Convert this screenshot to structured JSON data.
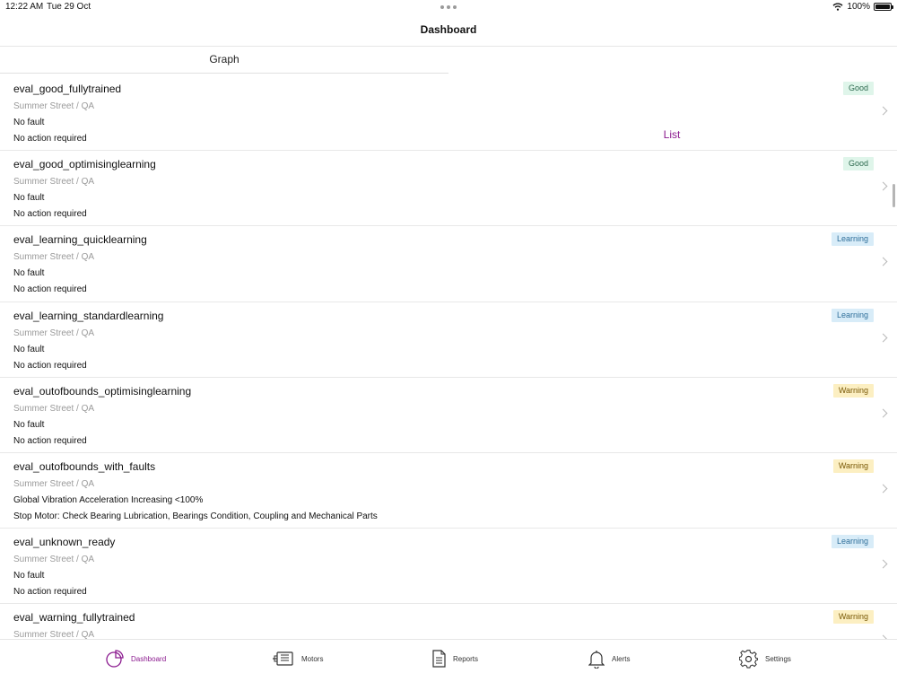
{
  "status": {
    "time": "12:22 AM",
    "date": "Tue 29 Oct",
    "battery": "100%"
  },
  "nav": {
    "title": "Dashboard"
  },
  "tabs": [
    {
      "label": "Graph"
    },
    {
      "label": "List"
    }
  ],
  "rows": [
    {
      "name": "eval_good_fullytrained",
      "location": "Summer Street / QA",
      "fault": "No fault",
      "action": "No action required",
      "status": "Good"
    },
    {
      "name": "eval_good_optimisinglearning",
      "location": "Summer Street / QA",
      "fault": "No fault",
      "action": "No action required",
      "status": "Good"
    },
    {
      "name": "eval_learning_quicklearning",
      "location": "Summer Street / QA",
      "fault": "No fault",
      "action": "No action required",
      "status": "Learning"
    },
    {
      "name": "eval_learning_standardlearning",
      "location": "Summer Street / QA",
      "fault": "No fault",
      "action": "No action required",
      "status": "Learning"
    },
    {
      "name": "eval_outofbounds_optimisinglearning",
      "location": "Summer Street / QA",
      "fault": "No fault",
      "action": "No action required",
      "status": "Warning"
    },
    {
      "name": "eval_outofbounds_with_faults",
      "location": "Summer Street / QA",
      "fault": "Global Vibration Acceleration Increasing <100%",
      "action": "Stop Motor: Check Bearing Lubrication, Bearings Condition, Coupling and Mechanical Parts",
      "status": "Warning"
    },
    {
      "name": "eval_unknown_ready",
      "location": "Summer Street / QA",
      "fault": "No fault",
      "action": "No action required",
      "status": "Learning"
    },
    {
      "name": "eval_warning_fullytrained",
      "location": "Summer Street / QA",
      "fault": "",
      "action": "",
      "status": "Warning"
    }
  ],
  "tabbar": [
    {
      "label": "Dashboard",
      "icon": "dashboard-pie-icon"
    },
    {
      "label": "Motors",
      "icon": "motor-icon"
    },
    {
      "label": "Reports",
      "icon": "report-document-icon"
    },
    {
      "label": "Alerts",
      "icon": "bell-icon"
    },
    {
      "label": "Settings",
      "icon": "gear-icon"
    }
  ],
  "colors": {
    "accent": "#8b1a8f",
    "good_bg": "#dff5ea",
    "learning_bg": "#d8ecf8",
    "warning_bg": "#fcefc2"
  }
}
